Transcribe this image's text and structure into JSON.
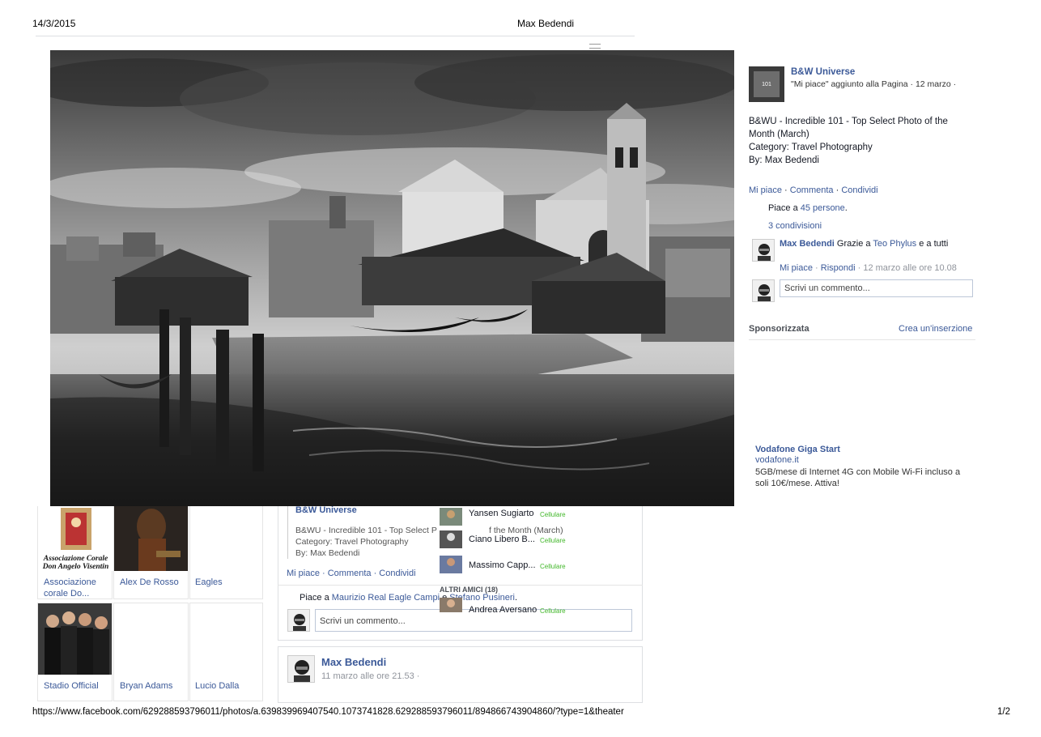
{
  "print": {
    "date": "14/3/2015",
    "title": "Max Bedendi",
    "url": "https://www.facebook.com/629288593796011/photos/a.639839969407540.1073741828.629288593796011/894866743904860/?type=1&theater",
    "page": "1/2"
  },
  "photo": {
    "description_icon": "venice-boatyard-photo"
  },
  "post": {
    "page_name": "B&W Universe",
    "meta": "\"Mi piace\" aggiunto alla Pagina · 12 marzo ·",
    "caption_lines": [
      "B&WU - Incredible 101 - Top Select Photo of the Month (March)",
      "Category: Travel Photography",
      "By: Max Bedendi"
    ],
    "actions": {
      "like": "Mi piace",
      "comment": "Commenta",
      "share": "Condividi",
      "sep": " · "
    },
    "likes_prefix": "Piace a ",
    "likes_link": "45 persone",
    "likes_suffix": ".",
    "shares": "3 condivisioni",
    "comment": {
      "author": "Max Bedendi",
      "text_prefix": " Grazie a ",
      "mention": "Teo Phylus",
      "text_suffix": " e a tutti",
      "like": "Mi piace",
      "reply": "Rispondi",
      "time": " · 12 marzo alle ore 10.08"
    },
    "comment_placeholder": "Scrivi un commento..."
  },
  "sponsored": {
    "label": "Sponsorizzata",
    "create_ad": "Crea un'inserzione",
    "ad": {
      "title": "Vodafone Giga Start",
      "domain": "vodafone.it",
      "body": "5GB/mese di Internet 4G con Mobile Wi-Fi incluso a soli 10€/mese. Attiva!"
    }
  },
  "left_grid": {
    "row1": [
      {
        "label": "Associazione corale Do...",
        "thumb_caption": "Associazione Corale Don Angelo Visentin"
      },
      {
        "label": "Alex De Rosso"
      },
      {
        "label": "Eagles"
      }
    ],
    "row2": [
      {
        "label": "Stadio Official"
      },
      {
        "label": "Bryan Adams"
      },
      {
        "label": "Lucio Dalla"
      }
    ]
  },
  "feed": {
    "shared_page": "B&W Universe",
    "shared_text": "B&WU - Incredible 101 - Top Select P",
    "shared_text_tail": "f the Month (March)",
    "shared_category": "Category: Travel Photography",
    "shared_by": "By: Max Bedendi",
    "actions": "Mi piace · Commenta · Condividi",
    "likes_prefix": "Piace a ",
    "likes_names": "Maurizio Real Eagle Campi",
    "likes_and": " e ",
    "likes_names2": "Stefano Pusineri",
    "likes_suffix": ".",
    "comment_placeholder": "Scrivi un commento...",
    "post2_author": "Max Bedendi",
    "post2_time": "11 marzo alle ore 21.53 ·"
  },
  "chat": {
    "online": [
      {
        "name": "Yansen Sugiarto",
        "status": "Cellulare"
      },
      {
        "name": "Ciano Libero B...",
        "status": "Cellulare"
      },
      {
        "name": "Massimo Capp...",
        "status": "Cellulare"
      }
    ],
    "other_header": "ALTRI AMICI (18)",
    "other": [
      {
        "name": "Andrea Aversano",
        "status": "Cellulare"
      }
    ]
  }
}
